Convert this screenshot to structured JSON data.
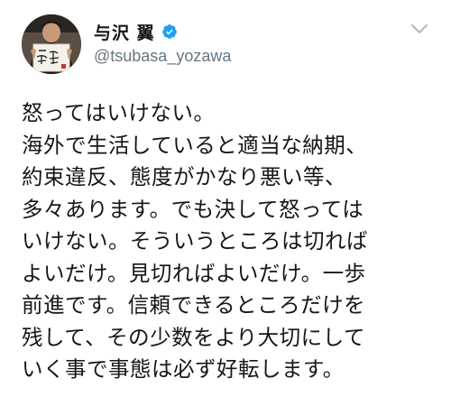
{
  "tweet": {
    "author": {
      "display_name": "与沢 翼",
      "handle": "@tsubasa_yozawa",
      "verified": true,
      "avatar_sign_text": "一点突破"
    },
    "lines": [
      "怒ってはいけない。",
      "海外で生活していると適当な納期、",
      "約束違反、態度がかなり悪い等、",
      "多々あります。でも決して怒っては",
      "いけない。そういうところは切れば",
      "よいだけ。見切ればよいだけ。一歩",
      "前進です。信頼できるところだけを",
      "残して、その少数をより大切にして",
      "いく事で事態は必ず好転します。"
    ]
  },
  "colors": {
    "text": "#14171a",
    "secondary": "#657786",
    "verified_badge": "#1da1f2",
    "caret": "#aab8c2"
  },
  "icons": {
    "verified": "verified-badge-icon",
    "menu": "chevron-down-icon"
  }
}
